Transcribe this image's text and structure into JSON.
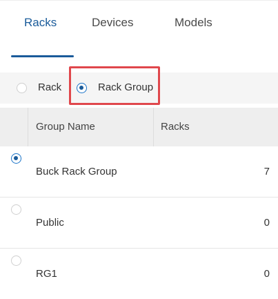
{
  "tabs": [
    {
      "label": "Racks"
    },
    {
      "label": "Devices"
    },
    {
      "label": "Models"
    }
  ],
  "view_toggle": {
    "rack_label": "Rack",
    "rack_group_label": "Rack Group",
    "selected": "Rack Group"
  },
  "table": {
    "headers": [
      "Group Name",
      "Racks"
    ],
    "rows": [
      {
        "name": "Buck Rack Group",
        "racks": "7",
        "selected": true
      },
      {
        "name": "Public",
        "racks": "0",
        "selected": false
      },
      {
        "name": "RG1",
        "racks": "0",
        "selected": false
      }
    ]
  },
  "colors": {
    "accent": "#1a5b9a",
    "highlight": "#e0474c"
  }
}
